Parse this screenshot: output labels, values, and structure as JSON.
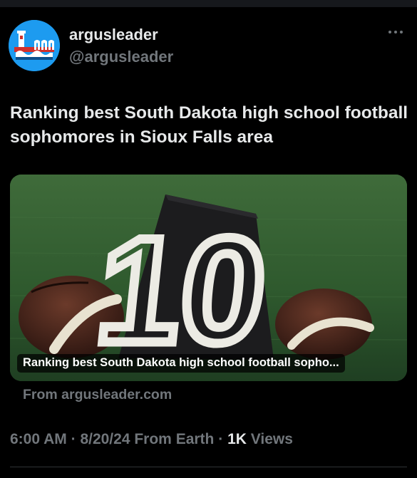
{
  "tweet": {
    "display_name": "argusleader",
    "handle": "@argusleader",
    "more_icon": "more-horizontal-icon",
    "text": "Ranking best South Dakota high school football sophomores in Sioux Falls area",
    "card": {
      "image_caption": "Ranking best South Dakota high school football sopho...",
      "image_content": "Football yard marker \"10\" between two footballs on grass",
      "sign_number": "10",
      "source": "From argusleader.com"
    },
    "meta": {
      "time": "6:00 AM",
      "separator": "·",
      "date": "8/20/24",
      "source": "From Earth",
      "views_count": "1K",
      "views_label": "Views"
    }
  },
  "colors": {
    "background": "#000000",
    "primary_text": "#e7e9ea",
    "secondary_text": "#71767b",
    "avatar_bg": "#1d9bf0"
  }
}
